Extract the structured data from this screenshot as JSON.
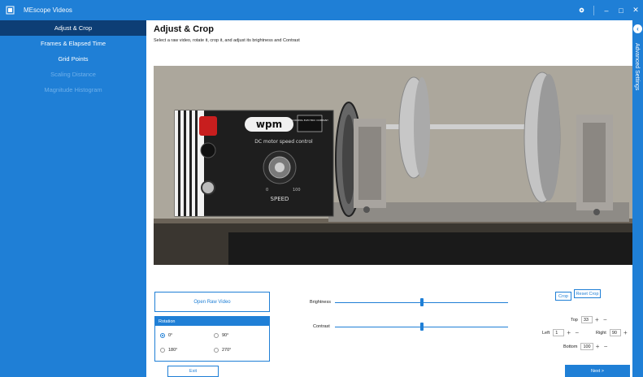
{
  "titlebar": {
    "title": "MEscope Videos",
    "icons": [
      "app-icon",
      "gear-icon",
      "minimize-icon",
      "maximize-icon",
      "close-icon"
    ]
  },
  "sidebar": {
    "items": [
      {
        "label": "Adjust & Crop",
        "state": "active"
      },
      {
        "label": "Frames & Elapsed Time",
        "state": "enabled"
      },
      {
        "label": "Grid Points",
        "state": "enabled"
      },
      {
        "label": "Scaling Distance",
        "state": "disabled"
      },
      {
        "label": "Magnitude Histogram",
        "state": "disabled"
      }
    ]
  },
  "main": {
    "title": "Adjust & Crop",
    "subtitle": "Select a raw video, rotate it, crop it, and adjust its brightness and Contrast"
  },
  "video": {
    "meter_brand": "wpm",
    "meter_company": "GOODING ELECTRIC COMPANY",
    "meter_caption": "DC motor speed control",
    "speed_label": "SPEED",
    "knob_min": "0",
    "knob_max": "100"
  },
  "controls": {
    "open_raw_video_label": "Open Raw Video",
    "rotation": {
      "header": "Rotation",
      "options": [
        "0°",
        "90°",
        "180°",
        "270°"
      ],
      "selected": "0°"
    },
    "exit_label": "Exit",
    "brightness": {
      "label": "Brightness",
      "level": 0.5
    },
    "contrast": {
      "label": "Contrast",
      "level": 0.5
    },
    "crop_label": "Crop",
    "reset_crop_label": "Reset Crop",
    "crop_top": {
      "label": "Top",
      "value": "33"
    },
    "crop_left": {
      "label": "Left",
      "value": "1"
    },
    "crop_right": {
      "label": "Right",
      "value": "90"
    },
    "crop_bottom": {
      "label": "Bottom",
      "value": "100"
    },
    "next_label": "Next >"
  },
  "right_strip": {
    "label": "Advanced Settings"
  },
  "colors": {
    "accent": "#1f7fd6",
    "active_nav": "#0d3e75",
    "disabled_nav_text": "#6fb0ea"
  }
}
